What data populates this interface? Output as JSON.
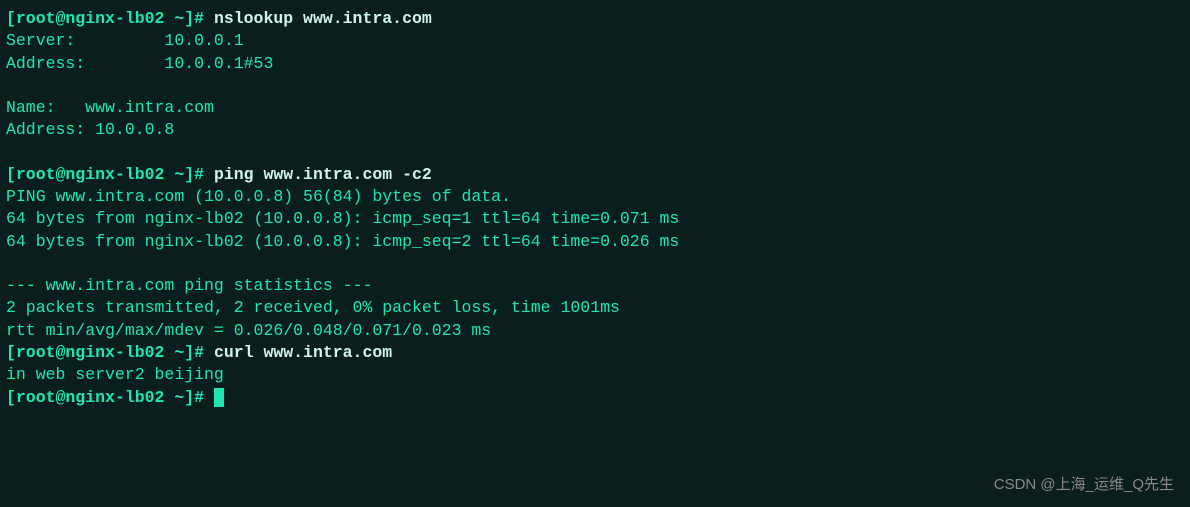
{
  "prompt": {
    "full": "[root@nginx-lb02 ~]# "
  },
  "commands": {
    "cmd1": "nslookup www.intra.com",
    "cmd2": "ping www.intra.com -c2",
    "cmd3": "curl www.intra.com"
  },
  "nslookup": {
    "server_line": "Server:         10.0.0.1",
    "address_line": "Address:        10.0.0.1#53",
    "name_line": "Name:   www.intra.com",
    "addr_line": "Address: 10.0.0.8"
  },
  "ping": {
    "header": "PING www.intra.com (10.0.0.8) 56(84) bytes of data.",
    "reply1": "64 bytes from nginx-lb02 (10.0.0.8): icmp_seq=1 ttl=64 time=0.071 ms",
    "reply2": "64 bytes from nginx-lb02 (10.0.0.8): icmp_seq=2 ttl=64 time=0.026 ms",
    "stats_header": "--- www.intra.com ping statistics ---",
    "stats_line1": "2 packets transmitted, 2 received, 0% packet loss, time 1001ms",
    "stats_line2": "rtt min/avg/max/mdev = 0.026/0.048/0.071/0.023 ms"
  },
  "curl": {
    "output": "in web server2 beijing"
  },
  "watermark": "CSDN @上海_运维_Q先生"
}
